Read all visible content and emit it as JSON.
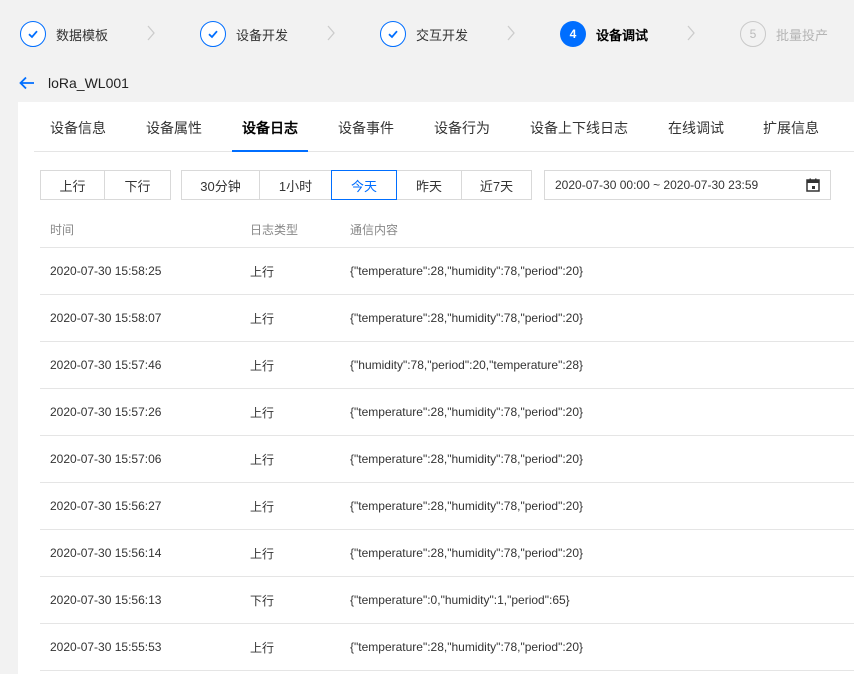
{
  "steps": [
    {
      "label": "数据模板",
      "status": "done"
    },
    {
      "label": "设备开发",
      "status": "done"
    },
    {
      "label": "交互开发",
      "status": "done"
    },
    {
      "label": "设备调试",
      "status": "active",
      "number": "4"
    },
    {
      "label": "批量投产",
      "status": "pending",
      "number": "5"
    }
  ],
  "header": {
    "device_name": "loRa_WL001"
  },
  "tabs": [
    "设备信息",
    "设备属性",
    "设备日志",
    "设备事件",
    "设备行为",
    "设备上下线日志",
    "在线调试",
    "扩展信息"
  ],
  "active_tab": "设备日志",
  "filters": {
    "direction": [
      "上行",
      "下行"
    ],
    "time": [
      "30分钟",
      "1小时",
      "今天",
      "昨天",
      "近7天"
    ],
    "active_time": "今天",
    "date_range": "2020-07-30 00:00 ~ 2020-07-30 23:59"
  },
  "table": {
    "columns": [
      "时间",
      "日志类型",
      "通信内容"
    ],
    "rows": [
      {
        "time": "2020-07-30 15:58:25",
        "type": "上行",
        "content": "{\"temperature\":28,\"humidity\":78,\"period\":20}"
      },
      {
        "time": "2020-07-30 15:58:07",
        "type": "上行",
        "content": "{\"temperature\":28,\"humidity\":78,\"period\":20}"
      },
      {
        "time": "2020-07-30 15:57:46",
        "type": "上行",
        "content": "{\"humidity\":78,\"period\":20,\"temperature\":28}"
      },
      {
        "time": "2020-07-30 15:57:26",
        "type": "上行",
        "content": "{\"temperature\":28,\"humidity\":78,\"period\":20}"
      },
      {
        "time": "2020-07-30 15:57:06",
        "type": "上行",
        "content": "{\"temperature\":28,\"humidity\":78,\"period\":20}"
      },
      {
        "time": "2020-07-30 15:56:27",
        "type": "上行",
        "content": "{\"temperature\":28,\"humidity\":78,\"period\":20}"
      },
      {
        "time": "2020-07-30 15:56:14",
        "type": "上行",
        "content": "{\"temperature\":28,\"humidity\":78,\"period\":20}"
      },
      {
        "time": "2020-07-30 15:56:13",
        "type": "下行",
        "content": "{\"temperature\":0,\"humidity\":1,\"period\":65}"
      },
      {
        "time": "2020-07-30 15:55:53",
        "type": "上行",
        "content": "{\"temperature\":28,\"humidity\":78,\"period\":20}"
      }
    ]
  },
  "colors": {
    "accent": "#006eff",
    "border": "#d9d9d9",
    "background": "#f2f2f2"
  }
}
